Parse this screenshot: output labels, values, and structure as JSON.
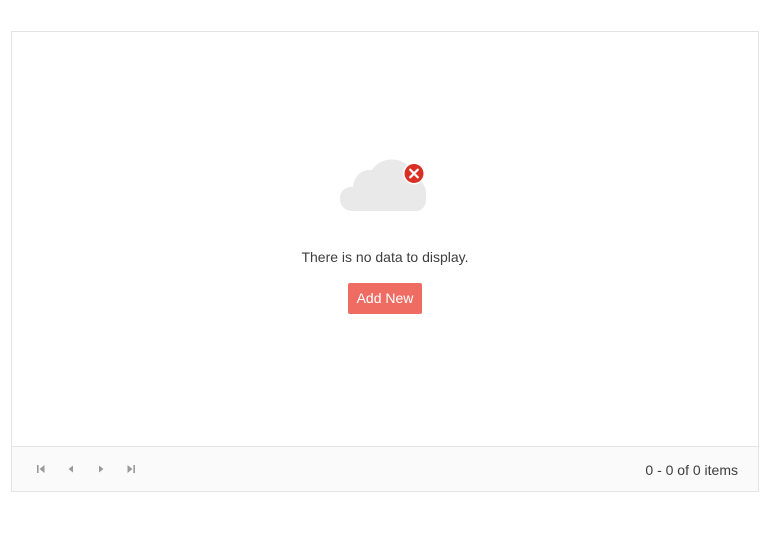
{
  "empty_state": {
    "icon": "cloud-error-icon",
    "message": "There is no data to display.",
    "add_button_label": "Add New"
  },
  "pager": {
    "buttons": [
      "first-page-icon",
      "previous-page-icon",
      "next-page-icon",
      "last-page-icon"
    ],
    "info": "0 - 0 of 0 items"
  },
  "colors": {
    "accent": "#ef6c63",
    "error_badge": "#d93025",
    "cloud": "#e9e9e9",
    "pager_icon": "#9a9a9a"
  }
}
